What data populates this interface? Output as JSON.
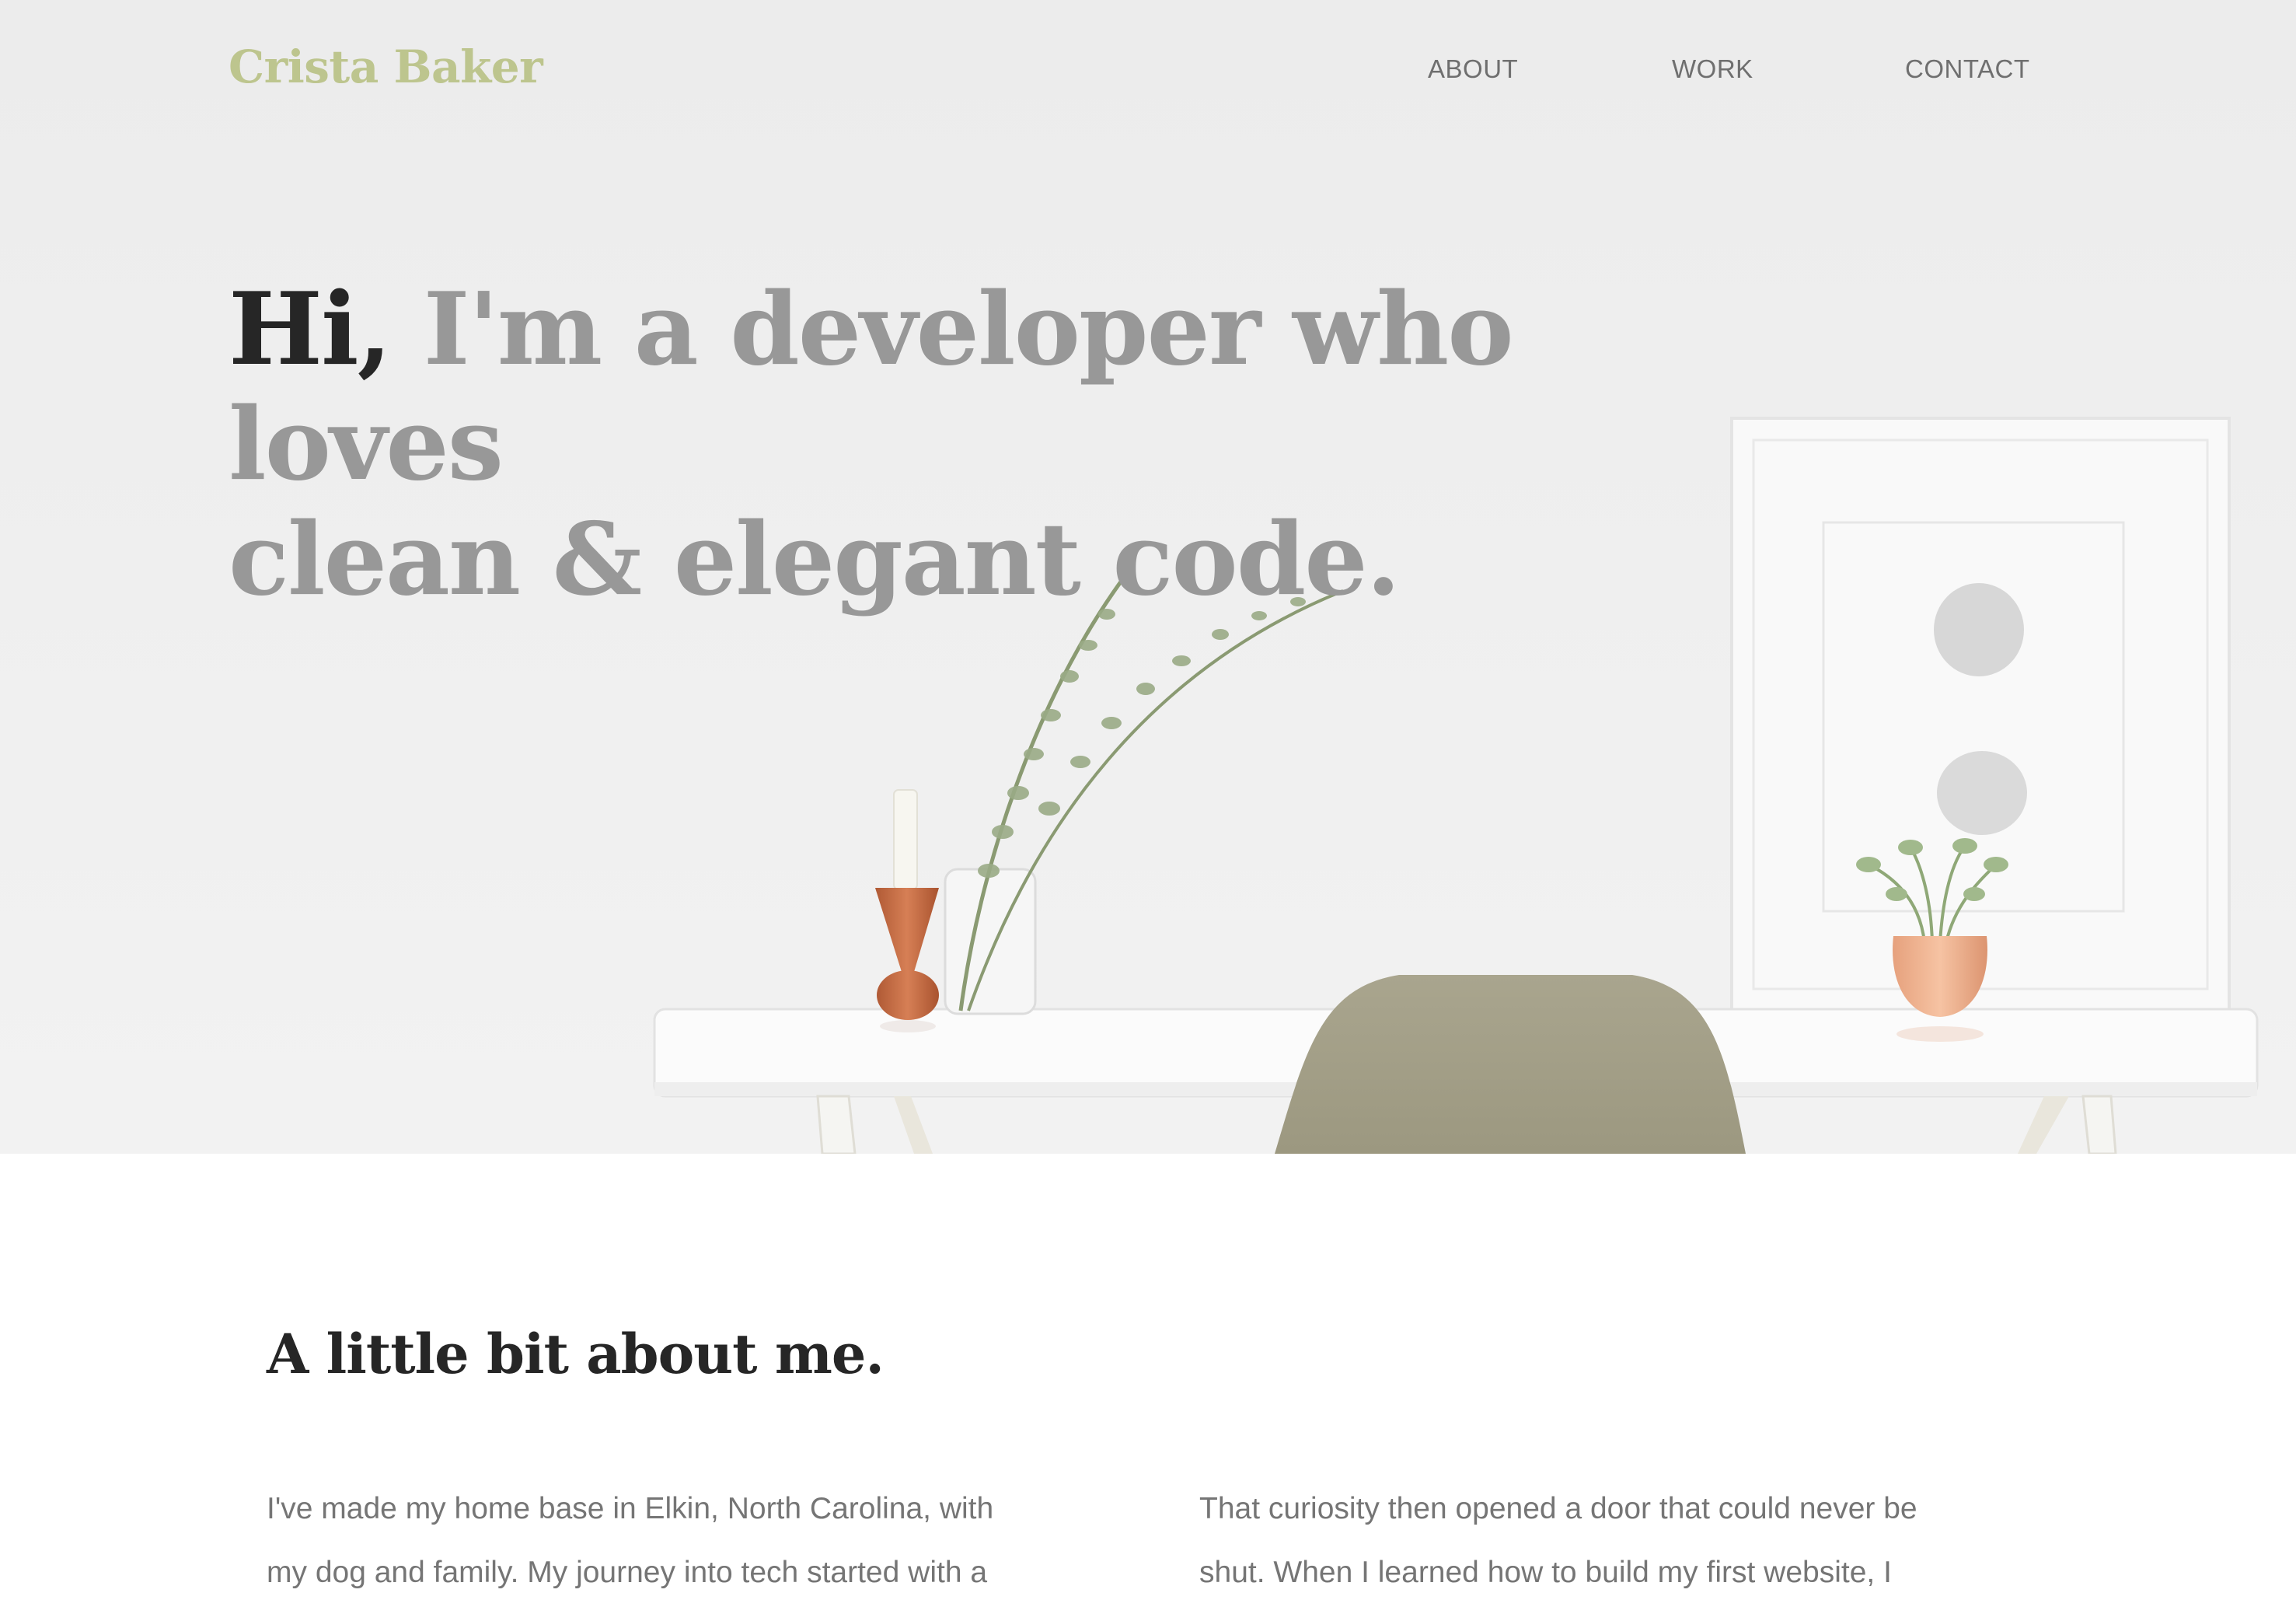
{
  "header": {
    "logo": "Crista Baker",
    "nav": [
      {
        "label": "ABOUT"
      },
      {
        "label": "WORK"
      },
      {
        "label": "CONTACT"
      }
    ]
  },
  "hero": {
    "headline_hi": "Hi,",
    "headline_line1": " I'm a developer who loves",
    "headline_line2": "clean & elegant code."
  },
  "about": {
    "title": "A little bit about me.",
    "left_line1": "I've made my home base in Elkin, North Carolina, with",
    "left_line2": "my dog and family. My journey into tech started with a",
    "right_line1": "That curiosity then opened a door that could never be",
    "right_line2": "shut. When I learned how to build my first website, I"
  },
  "colors": {
    "logo": "#bdc58e",
    "headline_accent": "#262626",
    "headline_muted": "#989898",
    "body_text": "#757575"
  }
}
